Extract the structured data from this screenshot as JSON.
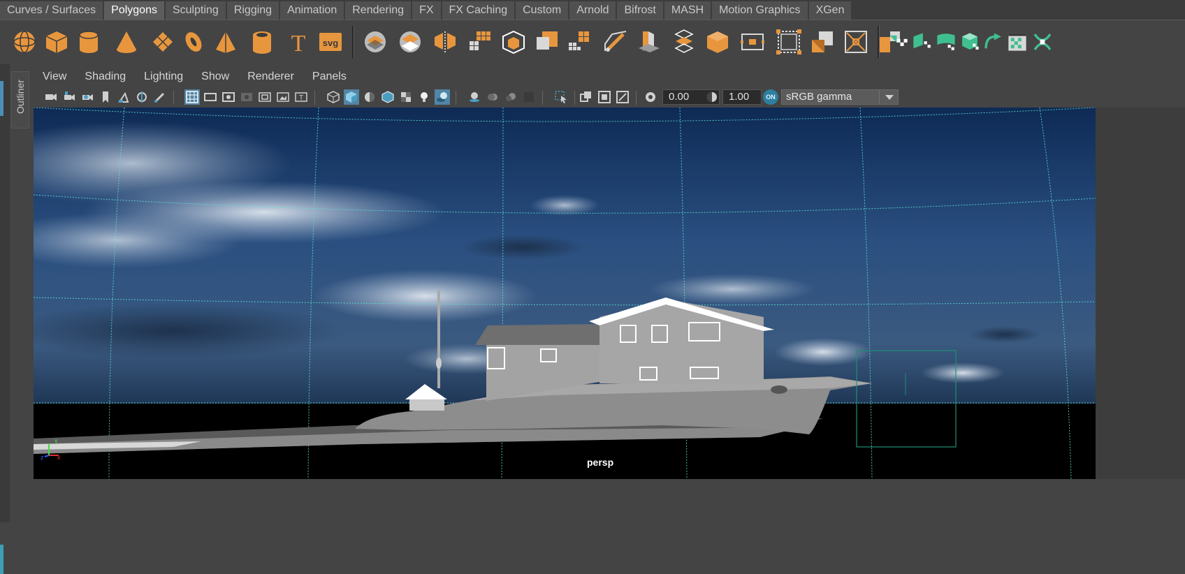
{
  "shelf_tabs": [
    "Curves / Surfaces",
    "Polygons",
    "Sculpting",
    "Rigging",
    "Animation",
    "Rendering",
    "FX",
    "FX Caching",
    "Custom",
    "Arnold",
    "Bifrost",
    "MASH",
    "Motion Graphics",
    "XGen"
  ],
  "active_tab": "Polygons",
  "shelf": {
    "type_label": "T",
    "svg_label": "svg",
    "icons": [
      "poly-sphere-icon",
      "poly-cube-icon",
      "poly-cylinder-icon",
      "poly-cone-icon",
      "poly-plane-icon",
      "poly-torus-icon",
      "poly-pyramid-icon",
      "poly-pipe-icon",
      "type-tool-icon",
      "svg-tool-icon",
      "combine-icon",
      "separate-icon",
      "mirror-icon",
      "smooth-icon",
      "extract-icon",
      "boolean-icon",
      "reduce-icon",
      "bevel-icon",
      "extrude-icon",
      "bridge-icon",
      "append-icon",
      "multicut-icon",
      "target-weld-icon",
      "merge-icon",
      "merge-center-icon",
      "circularize-icon",
      "fill-hole-icon",
      "uv-planar-icon",
      "uv-cylindrical-icon",
      "uv-spherical-icon",
      "uv-automatic-icon",
      "uv-unfold-icon",
      "uv-checker-icon",
      "uv-editor-icon"
    ],
    "accent_orange": "#e8963e",
    "accent_green": "#3fbf8f"
  },
  "outliner_label": "Outliner",
  "panel_menu": [
    "View",
    "Shading",
    "Lighting",
    "Show",
    "Renderer",
    "Panels"
  ],
  "panel_toolbar": {
    "exposure": "0.00",
    "gamma_value": "1.00",
    "color_mgmt_badge": "ON",
    "color_space": "sRGB gamma",
    "active_color": "#5285a6"
  },
  "viewport": {
    "camera_label": "persp",
    "axis": {
      "x": "x",
      "y": "y",
      "z": "z"
    }
  }
}
